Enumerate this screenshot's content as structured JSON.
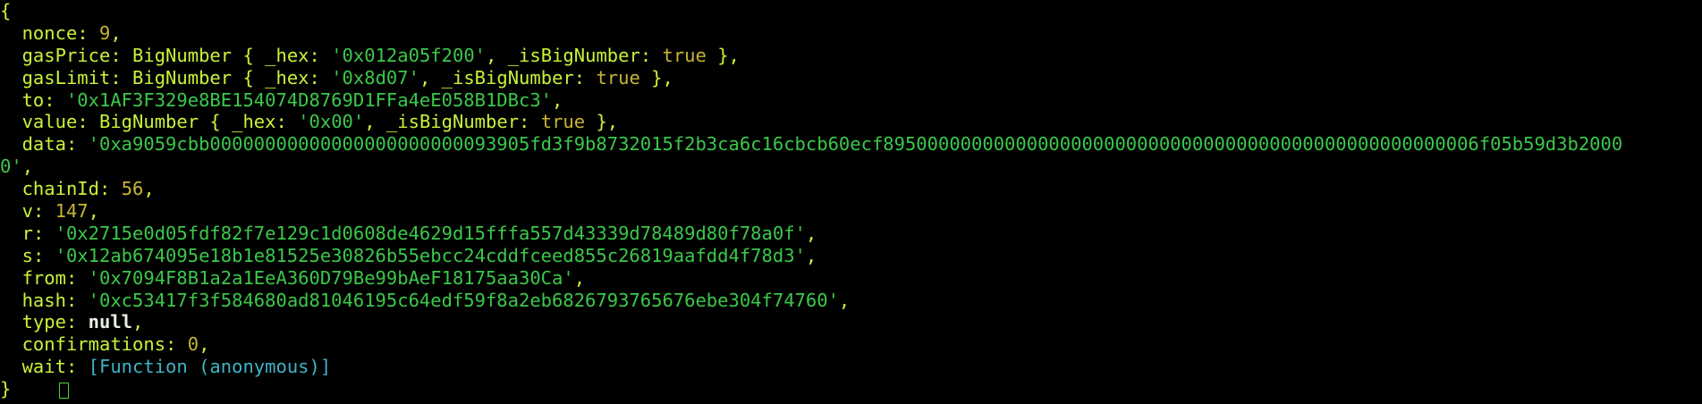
{
  "open_brace": "{",
  "close_brace": "}",
  "fields": {
    "nonce": {
      "key": "nonce",
      "value": "9"
    },
    "gasPrice": {
      "key": "gasPrice",
      "cls": "BigNumber",
      "hex_key": "_hex",
      "hex_value": "'0x012a05f200'",
      "flag_key": "_isBigNumber",
      "flag_value": "true"
    },
    "gasLimit": {
      "key": "gasLimit",
      "cls": "BigNumber",
      "hex_key": "_hex",
      "hex_value": "'0x8d07'",
      "flag_key": "_isBigNumber",
      "flag_value": "true"
    },
    "to": {
      "key": "to",
      "value": "'0x1AF3F329e8BE154074D8769D1FFa4eE058B1DBc3'"
    },
    "value": {
      "key": "value",
      "cls": "BigNumber",
      "hex_key": "_hex",
      "hex_value": "'0x00'",
      "flag_key": "_isBigNumber",
      "flag_value": "true"
    },
    "data": {
      "key": "data",
      "value_line1": "'0xa9059cbb00000000000000000000000093905fd3f9b8732015f2b3ca6c16cbcb60ecf895000000000000000000000000000000000000000000000000006f05b59d3b2000",
      "value_line2": "0'"
    },
    "chainId": {
      "key": "chainId",
      "value": "56"
    },
    "v": {
      "key": "v",
      "value": "147"
    },
    "r": {
      "key": "r",
      "value": "'0x2715e0d05fdf82f7e129c1d0608de4629d15fffa557d43339d78489d80f78a0f'"
    },
    "s": {
      "key": "s",
      "value": "'0x12ab674095e18b1e81525e30826b55ebcc24cddfceed855c26819aafdd4f78d3'"
    },
    "from": {
      "key": "from",
      "value": "'0x7094F8B1a2a1EeA360D79Be99bAeF18175aa30Ca'"
    },
    "hash": {
      "key": "hash",
      "value": "'0xc53417f3f584680ad81046195c64edf59f8a2eb6826793765676ebe304f74760'"
    },
    "type": {
      "key": "type",
      "value": "null"
    },
    "confirmations": {
      "key": "confirmations",
      "value": "0"
    },
    "wait": {
      "key": "wait",
      "value": "[Function (anonymous)]"
    }
  },
  "colors": {
    "background": "#000000",
    "key": "#c9f23a",
    "number": "#c6b533",
    "string": "#3bc84a",
    "function": "#3fb3c7",
    "null": "#e8f0e2"
  }
}
